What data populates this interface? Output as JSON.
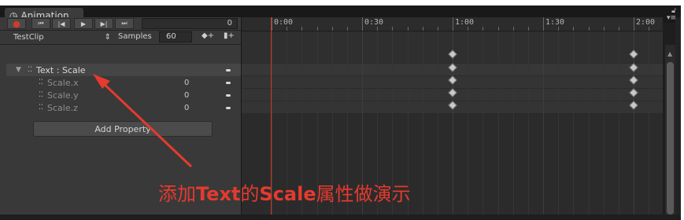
{
  "window": {
    "tab_title": "Animation",
    "tab_icon": "clock-icon",
    "lock_icon": "lock-icon",
    "menu_icon": "menu-icon"
  },
  "toolbar": {
    "buttons": [
      {
        "name": "record-button",
        "glyph": "●"
      },
      {
        "name": "first-key-button",
        "glyph": "⏮"
      },
      {
        "name": "prev-key-button",
        "glyph": "⏴|"
      },
      {
        "name": "play-button",
        "glyph": "▶"
      },
      {
        "name": "next-key-button",
        "glyph": "|⏵"
      },
      {
        "name": "last-key-button",
        "glyph": "⏭"
      }
    ],
    "current_frame": "0"
  },
  "clip_bar": {
    "clip_name": "TestClip",
    "samples_label": "Samples",
    "samples_value": "60",
    "add_keyframe_glyph": "◆+",
    "add_event_glyph": "▮+"
  },
  "ruler": {
    "labels": [
      "0:00",
      "0:30",
      "1:00",
      "1:30",
      "2:00"
    ]
  },
  "properties": {
    "parent": {
      "label": "Text : Scale"
    },
    "children": [
      {
        "label": "Scale.x",
        "value": "0"
      },
      {
        "label": "Scale.y",
        "value": "0"
      },
      {
        "label": "Scale.z",
        "value": "0"
      }
    ],
    "add_property_label": "Add Property"
  },
  "annotation": {
    "pre": "添加",
    "b1": "Text",
    "mid": "的",
    "b2": "Scale",
    "post": "属性做演示",
    "color": "#e53a2e"
  },
  "keyframe_times": [
    "1:00",
    "2:00"
  ]
}
